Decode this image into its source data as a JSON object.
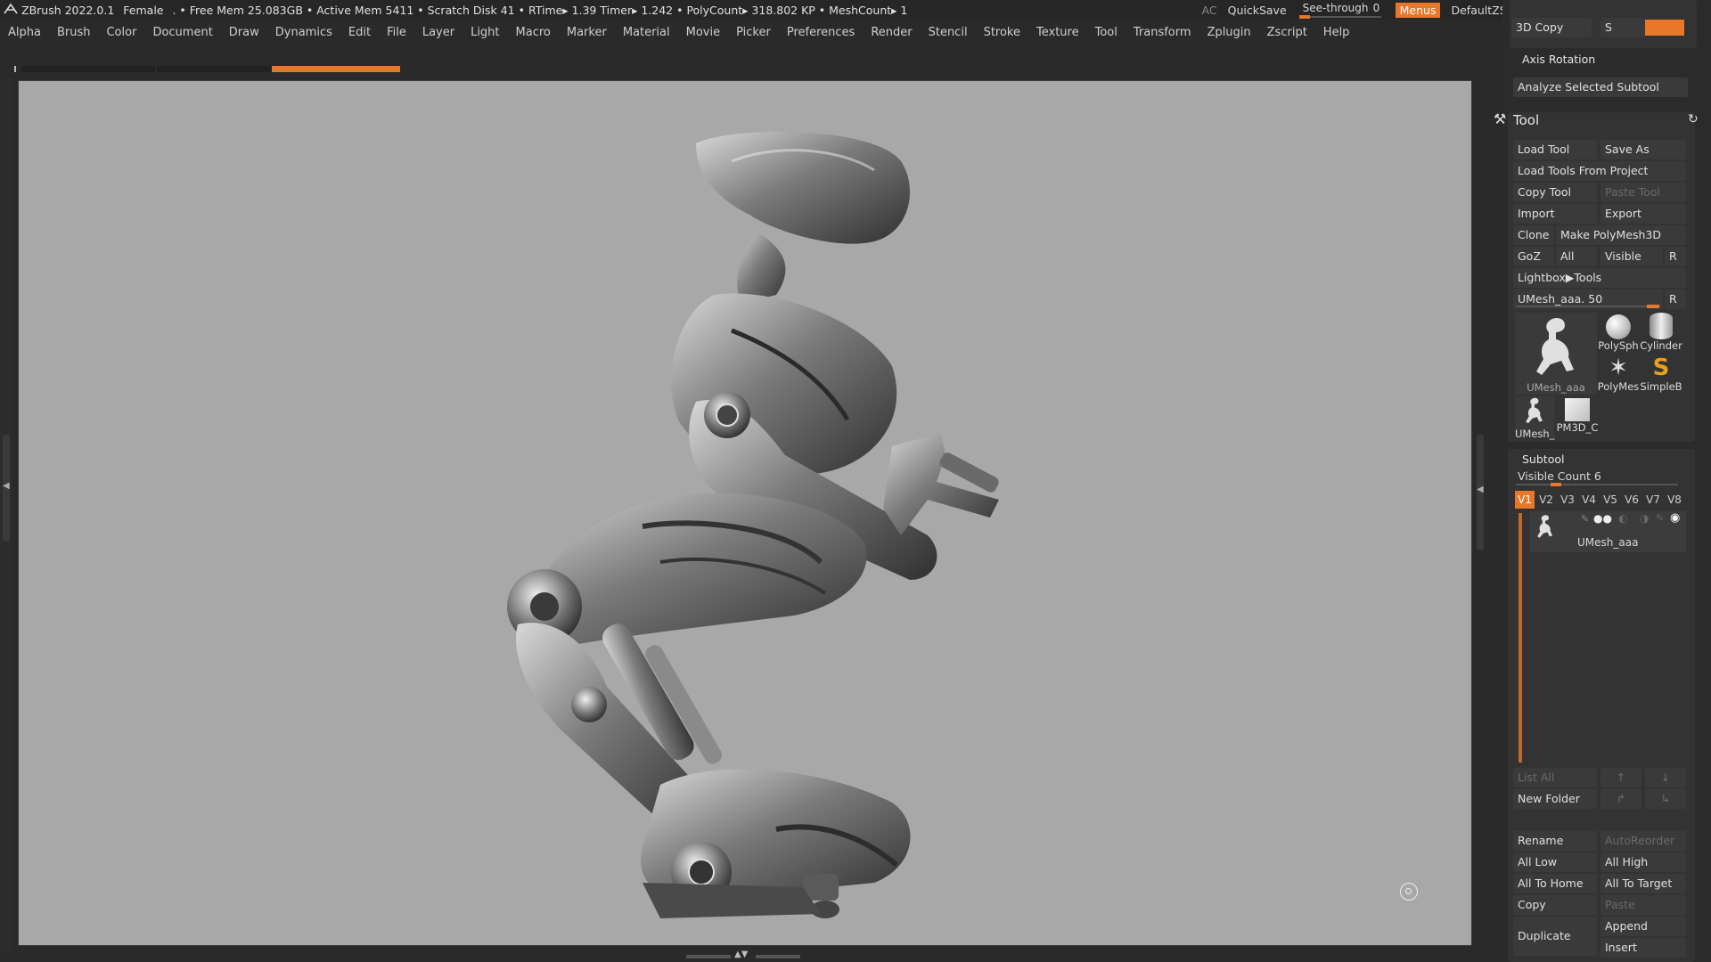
{
  "titlebar": {
    "app": "ZBrush 2022.0.1",
    "doc": "Female",
    "stats": ". • Free Mem 25.083GB • Active Mem 5411 • Scratch Disk 41 •  RTime▸ 1.39 Timer▸ 1.242 • PolyCount▸ 318.802 KP  • MeshCount▸ 1",
    "ac": "AC",
    "quicksave": "QuickSave",
    "seethrough_label": "See-through",
    "seethrough_value": "0",
    "seethrough_level": 0.0,
    "menus": "Menus",
    "script": "DefaultZScript"
  },
  "menubar": [
    "Alpha",
    "Brush",
    "Color",
    "Document",
    "Draw",
    "Dynamics",
    "Edit",
    "File",
    "Layer",
    "Light",
    "Macro",
    "Marker",
    "Material",
    "Movie",
    "Picker",
    "Preferences",
    "Render",
    "Stencil",
    "Stroke",
    "Texture",
    "Tool",
    "Transform",
    "Zplugin",
    "Zscript",
    "Help"
  ],
  "colors": {
    "accent": "#e8772a",
    "viewport_bg": "#a8a8a8",
    "panel_bg": "#2b2b2b",
    "button_bg": "#3a3a3a"
  },
  "panel": {
    "top": {
      "copy3d": "3D Copy",
      "s_label": "S",
      "axis_rotation": "Axis Rotation",
      "analyze": "Analyze Selected Subtool"
    },
    "tool": {
      "title": "Tool",
      "load_tool": "Load Tool",
      "save_as": "Save As",
      "load_from_project": "Load Tools From Project",
      "copy_tool": "Copy Tool",
      "paste_tool": "Paste Tool",
      "import": "Import",
      "export": "Export",
      "clone": "Clone",
      "make_polymesh": "Make PolyMesh3D",
      "goz": "GoZ",
      "all": "All",
      "visible": "Visible",
      "r": "R",
      "lightbox": "Lightbox▶Tools",
      "slider_label": "UMesh_aaa. 50",
      "slider_value": 50,
      "slider_r": "R",
      "thumbs": [
        "UMesh_aaa",
        "PolySph",
        "Cylinder",
        "PolyMes",
        "SimpleB",
        "UMesh_",
        "PM3D_C"
      ]
    },
    "subtool": {
      "title": "Subtool",
      "visible_count": "Visible Count 6",
      "versions": [
        "V1",
        "V2",
        "V3",
        "V4",
        "V5",
        "V6",
        "V7",
        "V8"
      ],
      "active_version": "V1",
      "item_name": "UMesh_aaa",
      "list_all": "List All",
      "new_folder": "New Folder",
      "rename": "Rename",
      "autoreorder": "AutoReorder",
      "all_low": "All Low",
      "all_high": "All High",
      "all_to_home": "All To Home",
      "all_to_target": "All To Target",
      "copy": "Copy",
      "paste": "Paste",
      "duplicate": "Duplicate",
      "append": "Append",
      "insert": "Insert"
    }
  }
}
